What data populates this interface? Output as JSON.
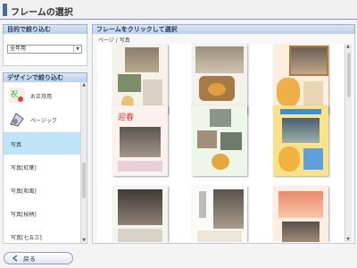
{
  "window": {
    "title": "フレームの選択"
  },
  "purpose": {
    "header": "目的で絞り込む",
    "selected": "全年用"
  },
  "design": {
    "header": "デザインで絞り込む",
    "items": [
      {
        "label": "お正月用"
      },
      {
        "label": "ページック"
      },
      {
        "label": "写真"
      },
      {
        "label": "写真[紅葉]"
      },
      {
        "label": "写真[和風]"
      },
      {
        "label": "写真[桜柄]"
      },
      {
        "label": "写真[七五三]"
      }
    ],
    "selected_index": 2
  },
  "frames": {
    "header": "フレームをクリックして選択",
    "category": "ページ / 写真"
  },
  "colors": {
    "accent": "#4a6a98",
    "selected": "#bfe4f7",
    "header_bg": "#c9d9ec"
  },
  "footer": {
    "back_label": "戻る"
  }
}
